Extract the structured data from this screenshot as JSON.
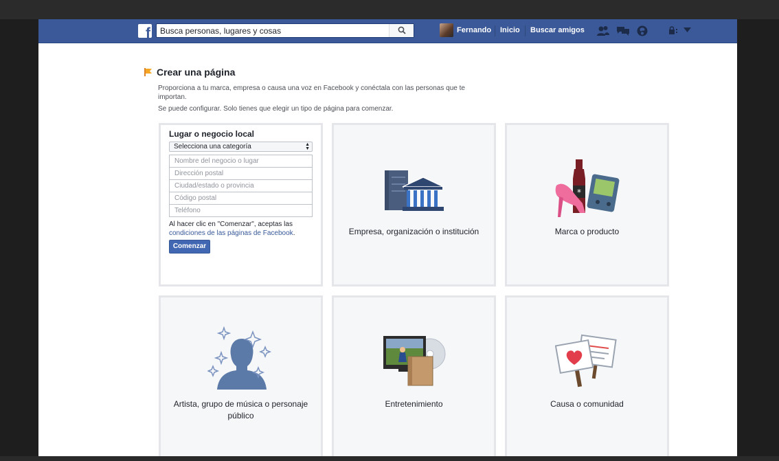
{
  "header": {
    "logo": "f",
    "search_placeholder": "Busca personas, lugares y cosas",
    "user_name": "Fernando",
    "nav_home": "Inicio",
    "nav_find_friends": "Buscar amigos",
    "icons": [
      "friend-requests-icon",
      "messages-icon",
      "notifications-icon",
      "privacy-lock-icon",
      "account-menu-icon"
    ]
  },
  "page": {
    "title": "Crear una página",
    "intro_line1": "Proporciona a tu marca, empresa o causa una voz en Facebook y conéctala con las personas que te importan.",
    "intro_line2": "Se puede configurar. Solo tienes que elegir un tipo de página para comenzar."
  },
  "local_form": {
    "title": "Lugar o negocio local",
    "category_select": "Selecciona una categoría",
    "fields": {
      "business_name": "Nombre del negocio o lugar",
      "address": "Dirección postal",
      "city": "Ciudad/estado o provincia",
      "zip": "Código postal",
      "phone": "Teléfono"
    },
    "terms_text": "Al hacer clic en \"Comenzar\", aceptas las ",
    "terms_link": "condiciones de las páginas de Facebook",
    "terms_end": ".",
    "submit": "Comenzar"
  },
  "categories": [
    {
      "label": "Empresa, organización o institución",
      "icon": "company-building-icon"
    },
    {
      "label": "Marca o producto",
      "icon": "brand-product-icon"
    },
    {
      "label": "Artista, grupo de música o personaje público",
      "icon": "artist-silhouette-icon"
    },
    {
      "label": "Entretenimiento",
      "icon": "entertainment-tv-icon"
    },
    {
      "label": "Causa o comunidad",
      "icon": "cause-signs-icon"
    }
  ],
  "colors": {
    "facebook_blue": "#3b5998",
    "button_blue": "#4267b2",
    "link_blue": "#365899",
    "card_bg": "#f6f7f9",
    "card_border": "#e5e6e9"
  }
}
